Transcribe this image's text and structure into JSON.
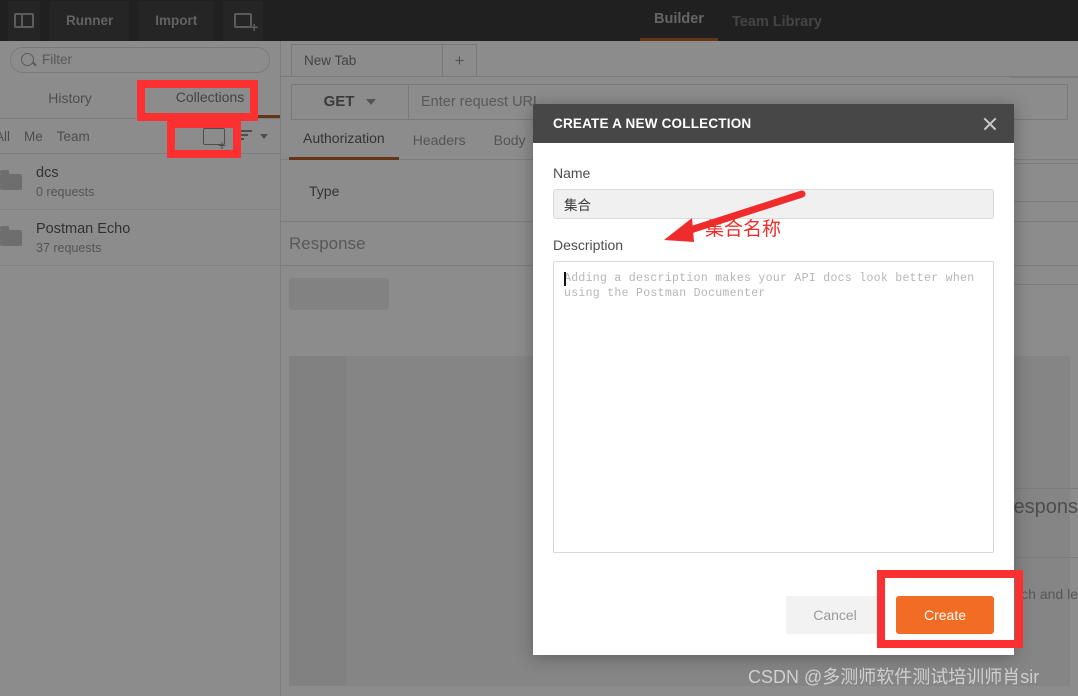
{
  "topbar": {
    "sidebar_toggle_icon": "sidebar-toggle-icon",
    "runner_label": "Runner",
    "import_label": "Import",
    "new_window_icon": "new-window-icon",
    "nav": [
      {
        "label": "Builder",
        "active": true
      },
      {
        "label": "Team Library",
        "active": false
      }
    ]
  },
  "sidebar": {
    "filter": {
      "placeholder": "Filter",
      "icon": "search-icon"
    },
    "tabs": [
      {
        "label": "History",
        "active": false
      },
      {
        "label": "Collections",
        "active": true
      }
    ],
    "scopes": [
      {
        "label": "All"
      },
      {
        "label": "Me"
      },
      {
        "label": "Team"
      }
    ],
    "new_folder_icon": "folder-plus-icon",
    "sort_icon": "sort-icon",
    "collections": [
      {
        "name": "dcs",
        "meta": "0 requests"
      },
      {
        "name": "Postman Echo",
        "meta": "37 requests"
      }
    ]
  },
  "main": {
    "request_tab": {
      "label": "New Tab"
    },
    "add_tab_label": "+",
    "method": "GET",
    "url_placeholder": "Enter request URL",
    "request_tabs": [
      {
        "label": "Authorization",
        "active": true
      },
      {
        "label": "Headers",
        "active": false
      },
      {
        "label": "Body",
        "active": false
      }
    ],
    "type_label": "Type",
    "response_label": "Response",
    "right_text_1": "respons",
    "right_text_2": "tch and le"
  },
  "modal": {
    "title": "CREATE A NEW COLLECTION",
    "close_icon": "close-icon",
    "name_label": "Name",
    "name_value": "集合",
    "description_label": "Description",
    "description_placeholder": "Adding a description makes your API docs look better when using the Postman Documenter",
    "cancel_label": "Cancel",
    "create_label": "Create"
  },
  "annotations": {
    "color": "#fc3030",
    "arrow_label": "集合名称",
    "boxes": [
      {
        "target": "collections-tab"
      },
      {
        "target": "new-collection-folder-button"
      },
      {
        "target": "create-button"
      }
    ]
  },
  "watermark": "CSDN @多测师软件测试培训师肖sir"
}
